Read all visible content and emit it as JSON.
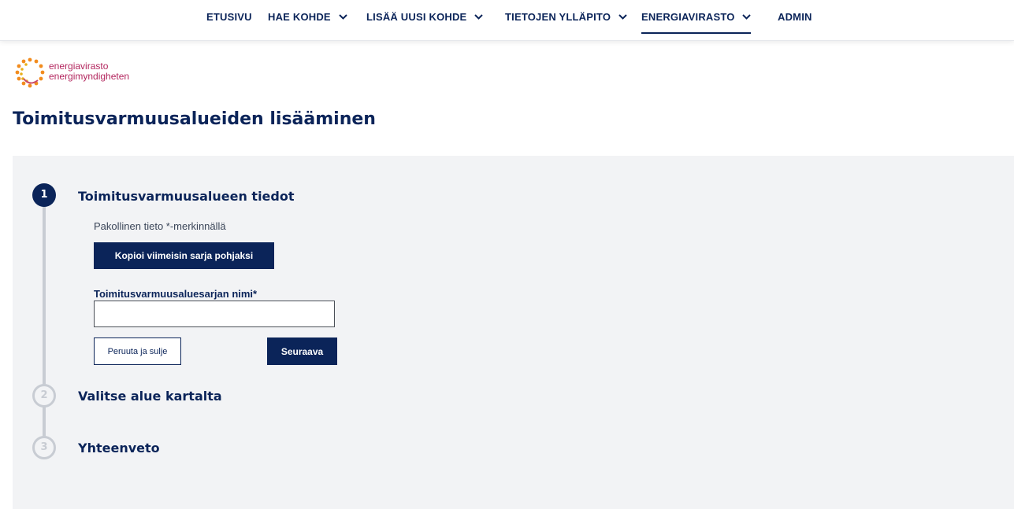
{
  "nav": {
    "items": [
      {
        "label": "ETUSIVU",
        "dropdown": false,
        "active": false
      },
      {
        "label": "HAE KOHDE",
        "dropdown": true,
        "active": false
      },
      {
        "label": "LISÄÄ UUSI KOHDE",
        "dropdown": true,
        "active": false
      },
      {
        "label": "TIETOJEN YLLÄPITO",
        "dropdown": true,
        "active": false
      },
      {
        "label": "ENERGIAVIRASTO",
        "dropdown": true,
        "active": true
      },
      {
        "label": "ADMIN",
        "dropdown": false,
        "active": false
      }
    ]
  },
  "logo": {
    "line1": "energiavirasto",
    "line2": "energimyndigheten"
  },
  "page": {
    "title": "Toimitusvarmuusalueiden lisääminen"
  },
  "steps": [
    {
      "number": "1",
      "title": "Toimitusvarmuusalueen tiedot",
      "state": "active"
    },
    {
      "number": "2",
      "title": "Valitse alue kartalta",
      "state": "inactive"
    },
    {
      "number": "3",
      "title": "Yhteenveto",
      "state": "inactive"
    }
  ],
  "form": {
    "required_note": "Pakollinen tieto *-merkinnällä",
    "copy_button": "Kopioi viimeisin sarja pohjaksi",
    "name_label": "Toimitusvarmuusaluesarjan nimi*",
    "name_value": "",
    "cancel_button": "Peruuta ja sulje",
    "next_button": "Seuraava"
  },
  "colors": {
    "primary": "#0b2459",
    "panel": "#f2f3f5",
    "inactive_step": "#c8ccd3",
    "logo_text": "#b3265e",
    "logo_orange": "#f28c1e"
  }
}
